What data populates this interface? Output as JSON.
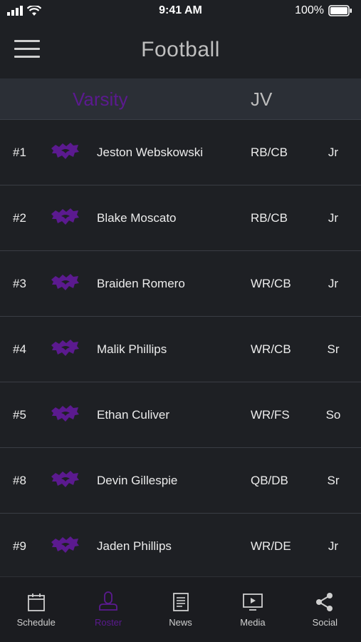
{
  "status_bar": {
    "time": "9:41 AM",
    "battery": "100%"
  },
  "header": {
    "title": "Football"
  },
  "tabs": [
    {
      "label": "Varsity",
      "active": true
    },
    {
      "label": "JV",
      "active": false
    }
  ],
  "roster": [
    {
      "number": "#1",
      "name": "Jeston Webskowski",
      "position": "RB/CB",
      "year": "Jr"
    },
    {
      "number": "#2",
      "name": "Blake Moscato",
      "position": "RB/CB",
      "year": "Jr"
    },
    {
      "number": "#3",
      "name": "Braiden Romero",
      "position": "WR/CB",
      "year": "Jr"
    },
    {
      "number": "#4",
      "name": "Malik Phillips",
      "position": "WR/CB",
      "year": "Sr"
    },
    {
      "number": "#5",
      "name": "Ethan Culiver",
      "position": "WR/FS",
      "year": "So"
    },
    {
      "number": "#8",
      "name": "Devin Gillespie",
      "position": "QB/DB",
      "year": "Sr"
    },
    {
      "number": "#9",
      "name": "Jaden Phillips",
      "position": "WR/DE",
      "year": "Jr"
    }
  ],
  "bottom_nav": [
    {
      "label": "Schedule",
      "icon": "calendar-icon",
      "active": false
    },
    {
      "label": "Roster",
      "icon": "person-icon",
      "active": true
    },
    {
      "label": "News",
      "icon": "newspaper-icon",
      "active": false
    },
    {
      "label": "Media",
      "icon": "video-icon",
      "active": false
    },
    {
      "label": "Social",
      "icon": "share-icon",
      "active": false
    }
  ],
  "colors": {
    "accent": "#5b1a8f",
    "background": "#1e2024",
    "tab_bar": "#2b2f36"
  }
}
